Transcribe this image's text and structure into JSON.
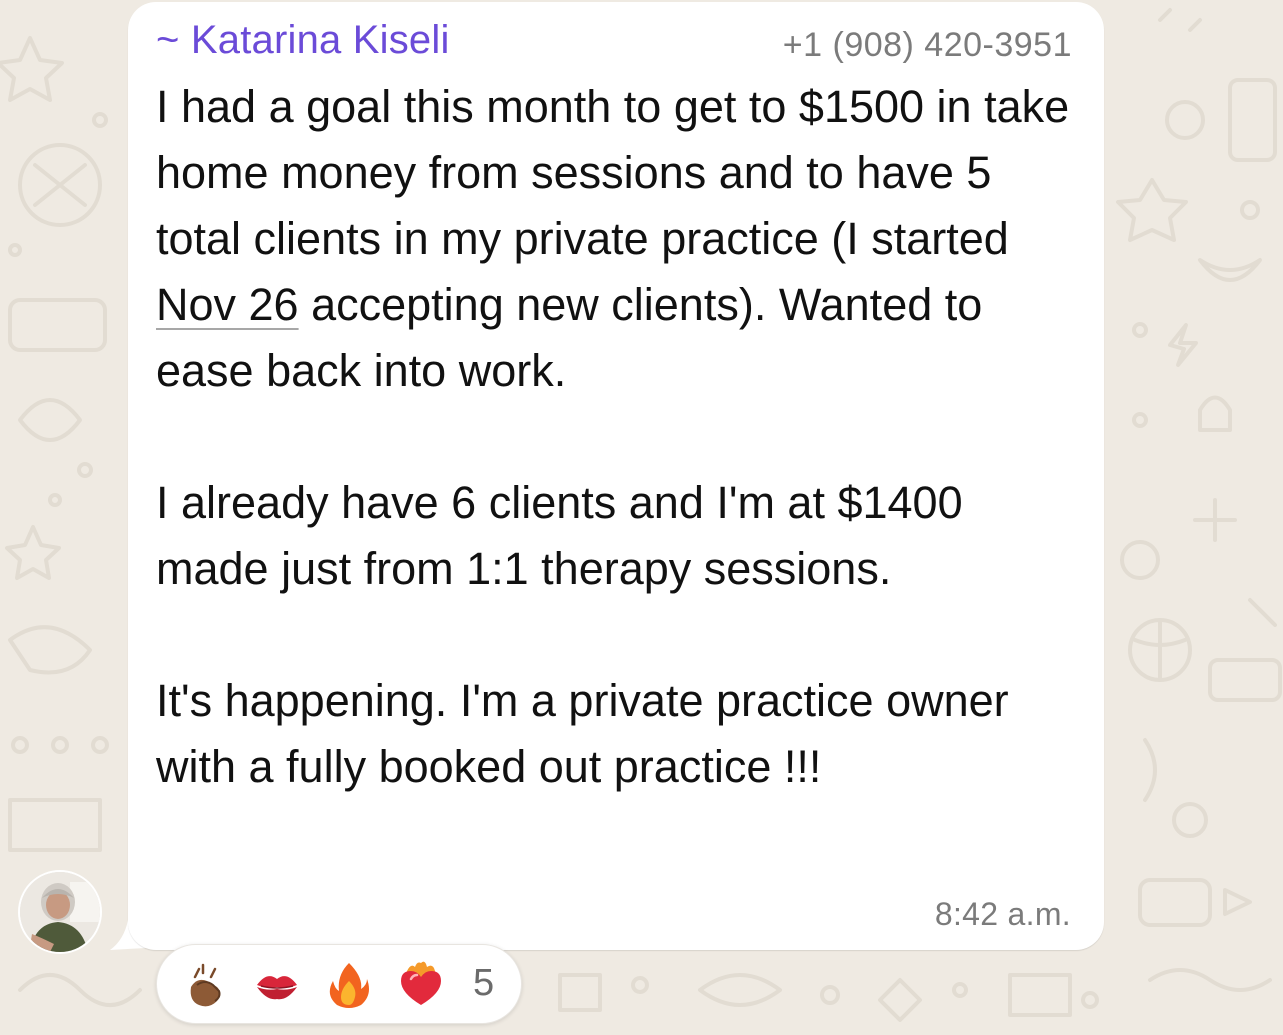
{
  "message": {
    "sender_name": "~ Katarina Kiseli",
    "sender_phone": "+1 (908) 420-3951",
    "paragraph1_before_date": "I had a goal this month to get to $1500 in take home money from sessions and to have 5 total clients in my private practice (I started ",
    "paragraph1_date": "Nov 26",
    "paragraph1_after_date": " accepting new clients). Wanted to ease back into work.",
    "paragraph2": "I already have 6 clients and I'm at $1400 made just from 1:1 therapy sessions.",
    "paragraph3": "It's happening. I'm a private practice owner with a fully booked out practice !!!",
    "timestamp": "8:42 a.m."
  },
  "reactions": {
    "items": [
      {
        "icon": "clapping-hands-icon"
      },
      {
        "icon": "kiss-mark-icon"
      },
      {
        "icon": "fire-icon"
      },
      {
        "icon": "heart-on-fire-icon"
      }
    ],
    "count": "5"
  },
  "colors": {
    "background": "#efeae2",
    "bubble": "#ffffff",
    "sender_name": "#6b4bd8",
    "meta_text": "#7b7b7b",
    "body_text": "#111111"
  }
}
